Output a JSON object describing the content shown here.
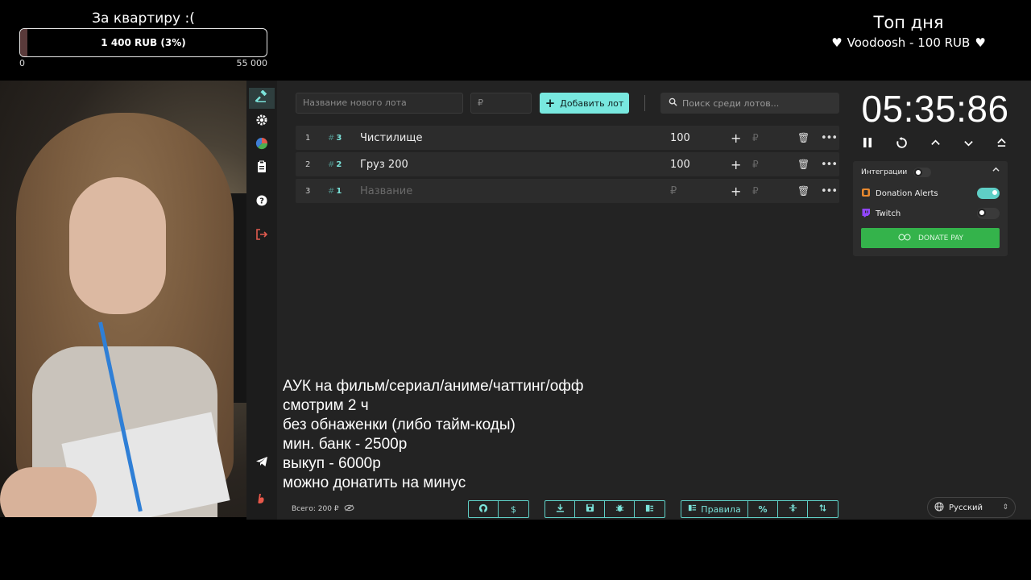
{
  "goal": {
    "title": "За квартиру :(",
    "label": "1 400 RUB (3%)",
    "progress": 0.03,
    "min": "0",
    "max": "55 000"
  },
  "top_day": {
    "title": "Топ дня",
    "entry": "Voodoosh - 100 RUB",
    "heart": "♥"
  },
  "sidebar": {
    "items": [
      {
        "icon": "hammer-icon",
        "active": true
      },
      {
        "icon": "gear-icon"
      },
      {
        "icon": "pie-chart-icon"
      },
      {
        "icon": "clipboard-icon"
      },
      {
        "icon": "help-icon"
      },
      {
        "icon": "logout-icon"
      },
      {
        "icon": "telegram-icon"
      },
      {
        "icon": "brand-b-icon"
      }
    ]
  },
  "toolbar": {
    "lot_name_placeholder": "Название нового лота",
    "price_placeholder": "₽",
    "add_label": "Добавить лот",
    "search_placeholder": "Поиск среди лотов..."
  },
  "lots": [
    {
      "index": "1",
      "tag": "3",
      "name": "Чистилище",
      "amount": "100",
      "placeholder": false
    },
    {
      "index": "2",
      "tag": "2",
      "name": "Груз 200",
      "amount": "100",
      "placeholder": false
    },
    {
      "index": "3",
      "tag": "1",
      "name": "Название",
      "amount": "₽",
      "placeholder": true
    }
  ],
  "row_rub": "₽",
  "rules": [
    "АУК на фильм/сериал/аниме/чаттинг/офф",
    "смотрим 2 ч",
    "без обнаженки (либо тайм-коды)",
    "мин. банк - 2500р",
    "выкуп - 6000р",
    "можно донатить на минус"
  ],
  "footer": {
    "total": "Всего: 200 ₽",
    "rules_button": "Правила",
    "percent_button": "%",
    "language": "Русский"
  },
  "timer": {
    "value": "05:35:86"
  },
  "integrations": {
    "title": "Интеграции",
    "enabled": false,
    "items": [
      {
        "name": "Donation Alerts",
        "enabled": true,
        "color": "#e8892f"
      },
      {
        "name": "Twitch",
        "enabled": false,
        "color": "#9146ff"
      }
    ],
    "donatepay_label": "DONATE PAY"
  },
  "colors": {
    "accent": "#78e8df",
    "donatepay": "#34b34b"
  }
}
